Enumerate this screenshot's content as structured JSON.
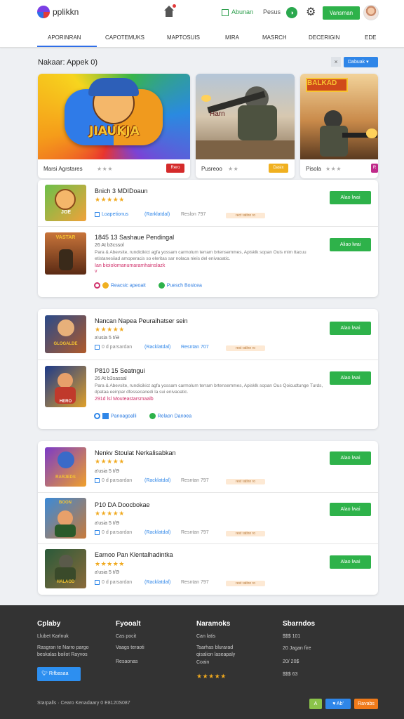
{
  "header": {
    "brand": "pplikkn",
    "nav_link_1": "Abunan",
    "nav_link_2": "Pesus",
    "round_badge": "◑",
    "cta_label": "Vansman"
  },
  "tabs": [
    "APORINRAN",
    "CAPOTEMUKS",
    "MAPTOSUIS",
    "MIRA",
    "MASRCH",
    "DECERIGIN",
    "EDE"
  ],
  "filter": {
    "label": "Nakaar: Appek 0)",
    "select": "Dabuak ▾",
    "close": "×"
  },
  "featured": [
    {
      "art_text": "JIAUKJA",
      "title": "Marsi Agrstares",
      "stars": "★★★",
      "badge": "Rero",
      "badge_color": "#d42a2a"
    },
    {
      "art_text": "Harn",
      "title": "Pusreoo",
      "stars": "★★",
      "badge": "Dasix",
      "badge_color": "#f0b020"
    },
    {
      "art_text": "BALKAD",
      "title": "Pisola",
      "stars": "★★★",
      "badge": "R",
      "badge_color": "#c02a8a"
    }
  ],
  "group1": [
    {
      "title": "Bnich 3  MDIDoaun",
      "stars": "★★★★★",
      "meta": "Loapetionus",
      "chip1": "(Rarklatdal)",
      "chip2": "Reslon   797",
      "pill": "rect ratlnn ro",
      "install": "Alao lwai",
      "thumb_text": "JOE"
    },
    {
      "title": "1845  13  Sashaue Pendingal",
      "stars": "",
      "meta": "",
      "sub1": "26 At b3cssol",
      "desc": "Para & Abevsite, rundicikict agfa yossam carmolum terram brtensemmes, Apisklk sopan Ouis mim ttacuu etistanesiiad amoperacis so eleritas sar nolaca nieis del enivaoatic.",
      "hl": "Ian bioiolomanumaramhainslazk",
      "hl2": "v",
      "tag1": "Reacsic apeoait",
      "tag2": "Puesch Bosicea",
      "install": "Aliao lwai",
      "thumb_text": "VASTAR"
    }
  ],
  "group2": [
    {
      "title": "Nancan  Napea Peuraihatser sein",
      "stars": "★★★★★",
      "sub1": "a'usia  5  t/Ə",
      "meta": "0  d parsardan",
      "chip1": "(Racklatdal)",
      "chip2": "Resntan   707",
      "pill": "rest ratlnn ro",
      "install": "Alao lwai",
      "thumb_text": "GLOGALDE"
    },
    {
      "title": "P810  15  Seatngui",
      "stars": "",
      "sub1": "26 At b3sassal",
      "desc": "Para & Abevsite, rundicikict agfa yossam carmolum terram brtensemmes, Apisklk sopan Ous Qoicudtunge Turds, dpataa eeinpar dfessecanedi la sui enivaoatic.",
      "hl": "291d  lsl Mouteastarsmaalb",
      "tag1": "Panoagoalli",
      "tag2": "Relaon Danoea",
      "install": "Alao lwai",
      "thumb_text": "HERO"
    }
  ],
  "group3": [
    {
      "title": "Nenkv  Stoulat Nerkalisabkan",
      "stars": "★★★★★",
      "sub1": "a'usia  5  t/Ə",
      "meta": "0  d parsardan",
      "chip1": "(Racklatdal)",
      "chip2": "Resntan   797",
      "pill": "rest ratlnn ro",
      "install": "Alao lwai",
      "thumb_text": "RARJEDS"
    },
    {
      "title": "P10  DA  Doocbokae",
      "stars": "★★★★★",
      "sub1": "a'usia  5  t/Ə",
      "meta": "0  d parsardan",
      "chip1": "(Racklatdal)",
      "chip2": "Resntan   797",
      "pill": "rest ratlnn ro",
      "install": "Alao lwai",
      "thumb_text": "BOON"
    },
    {
      "title": "Earnoo  Pan  Klentalhadintka",
      "stars": "★★★★★",
      "sub1": "a'usia  5  t/Ə",
      "meta": "0  d parsardan",
      "chip1": "(Racklatdal)",
      "chip2": "Resntan   797",
      "pill": "rest ratlnn ro",
      "install": "Alao lwai",
      "thumb_text": "HALAOD"
    }
  ],
  "footer": {
    "col1_title": "Cplaby",
    "col1_items": [
      "Llubet Karlnuk",
      "Rasgran te Narro pargo",
      "beskalas boilot Rayvos"
    ],
    "social": "Rifbasaa",
    "col2_title": "Fyooalt",
    "col2_items": [
      "Cas pocit",
      "Vaags teraoti",
      "Resaonas"
    ],
    "col3_title": "Naramoks",
    "col3_items": [
      "Can latis",
      "Tsarhas blurarad",
      "qisalion laseapaly",
      "Coain"
    ],
    "col3_stars": "★★★★★",
    "col4_title": "Sbarndos",
    "col4_items": [
      "$$$ 101",
      "20  Jagan  fire",
      "20/  20$",
      "$$$ 63"
    ],
    "copyright": "Starpalls  ·  Cearo Kenadaary    0 E8120S087",
    "badge1": "A",
    "badge2": "♥ Ab'",
    "badge3": "Ravabs"
  }
}
